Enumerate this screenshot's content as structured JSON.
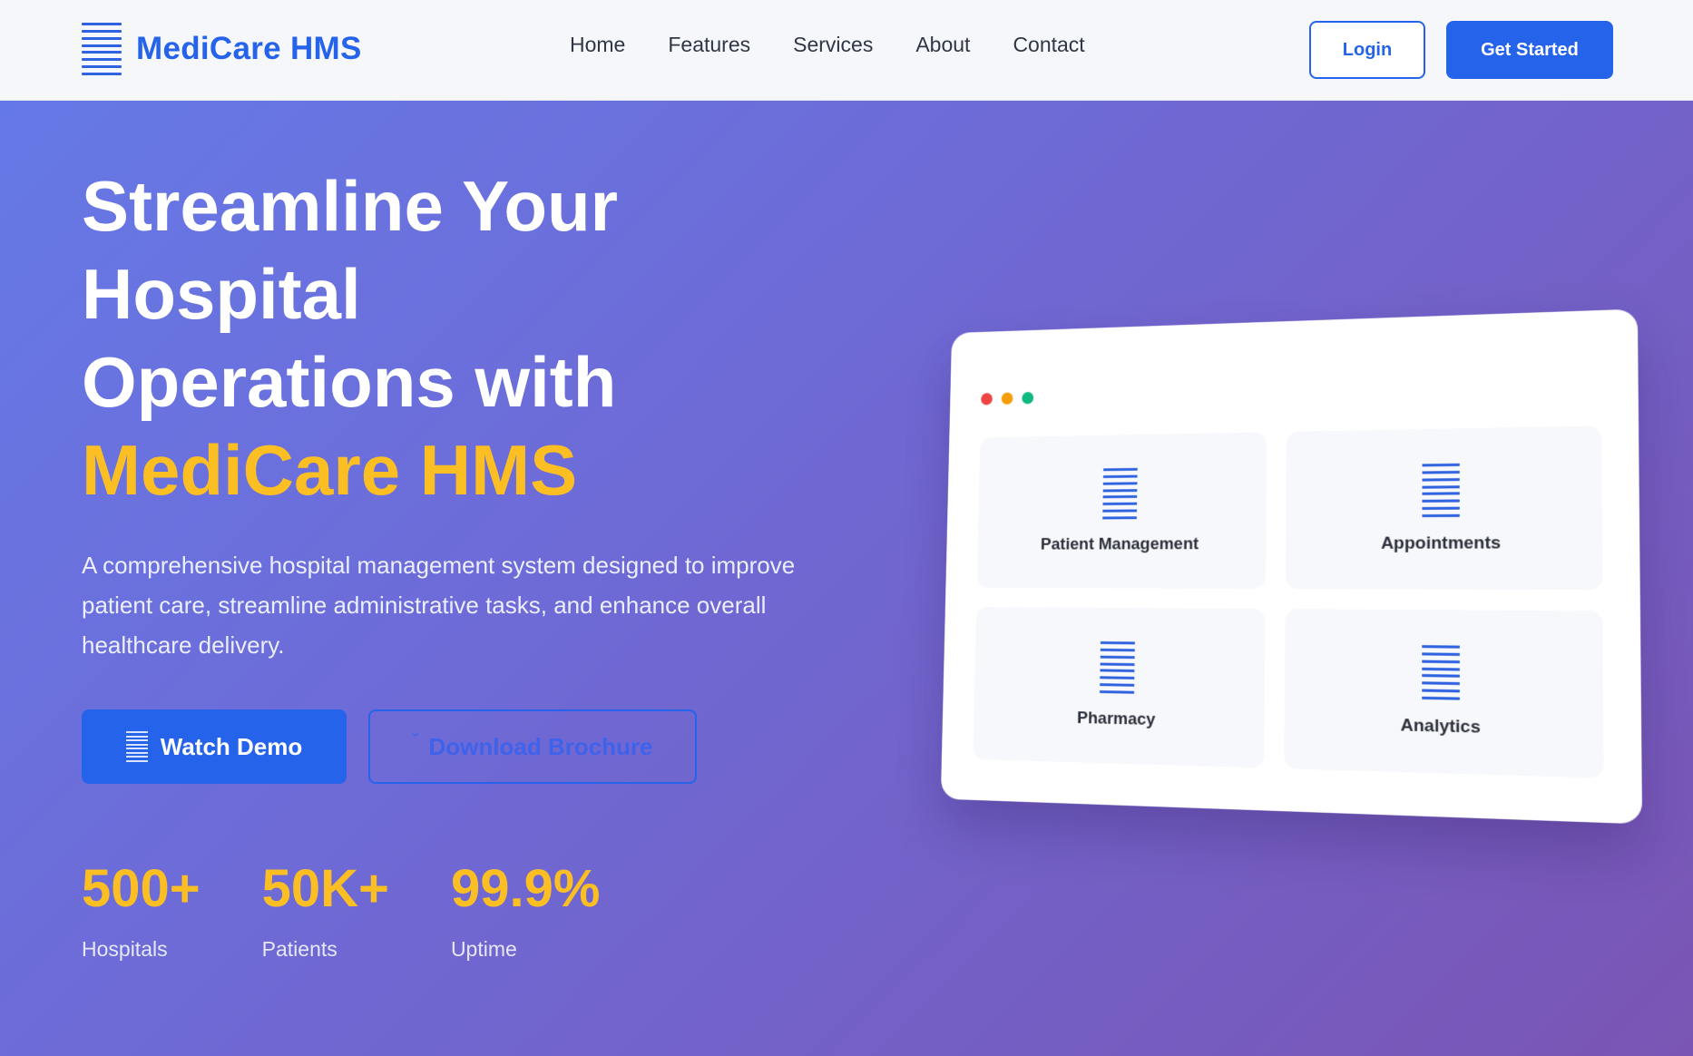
{
  "navbar": {
    "brand": "MediCare HMS",
    "brand_icon": "menu-lines-icon",
    "links": [
      "Home",
      "Features",
      "Services",
      "About",
      "Contact"
    ],
    "login_label": "Login",
    "get_started_label": "Get Started"
  },
  "hero": {
    "title_lines": [
      "Streamline Your",
      "Hospital",
      "Operations with"
    ],
    "title_accent": "MediCare HMS",
    "description": "A comprehensive hospital management system designed to improve patient care, streamline administrative tasks, and enhance overall healthcare delivery.",
    "watch_demo_label": "Watch Demo",
    "watch_demo_icon": "menu-lines-icon",
    "download_brochure_label": "Download Brochure",
    "download_brochure_icon": "download-icon",
    "stats": [
      {
        "value": "500+",
        "label": "Hospitals"
      },
      {
        "value": "50K+",
        "label": "Patients"
      },
      {
        "value": "99.9%",
        "label": "Uptime"
      }
    ]
  },
  "mockup": {
    "window_dots": [
      "red",
      "yellow",
      "green"
    ],
    "tiles": [
      {
        "label": "Patient Management",
        "icon": "menu-lines-icon"
      },
      {
        "label": "Appointments",
        "icon": "menu-lines-icon"
      },
      {
        "label": "Pharmacy",
        "icon": "menu-lines-icon"
      },
      {
        "label": "Analytics",
        "icon": "menu-lines-icon"
      }
    ]
  },
  "colors": {
    "primary": "#2563eb",
    "accent": "#fbbf24",
    "hero_gradient_start": "#6579e6",
    "hero_gradient_end": "#7a55b4"
  }
}
